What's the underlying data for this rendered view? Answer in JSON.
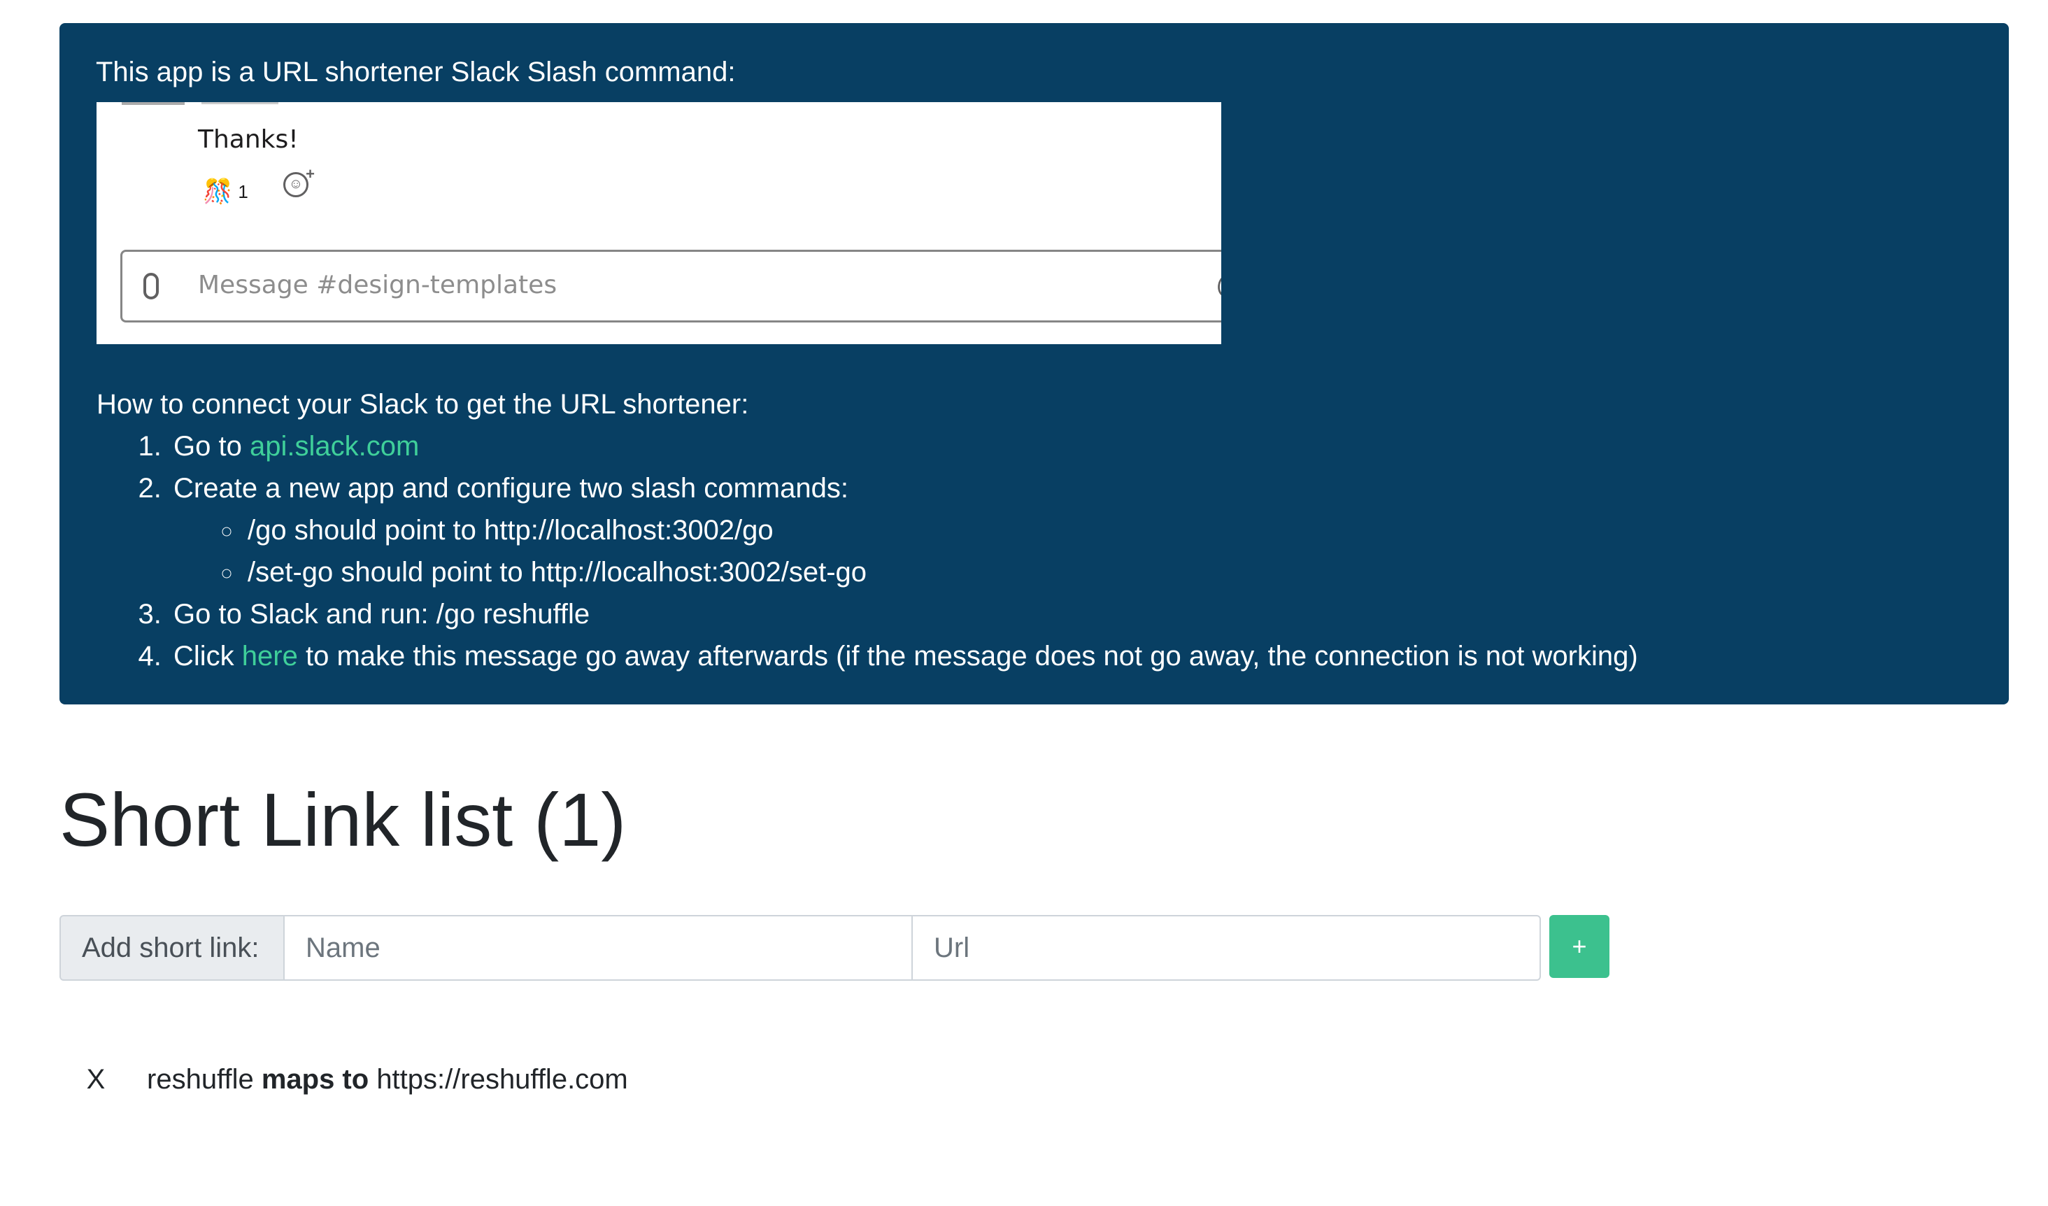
{
  "banner": {
    "intro": "This app is a URL shortener Slack Slash command:",
    "preview": {
      "message_text": "Thanks!",
      "reaction_emoji": "🎊",
      "reaction_count": "1",
      "composer_placeholder": "Message #design-templates",
      "icons": [
        "paperclip-icon",
        "add-reaction-icon",
        "at-icon"
      ]
    },
    "howto_heading": "How to connect your Slack to get the URL shortener:",
    "step1_prefix": "Go to",
    "step1_link": "api.slack.com",
    "step2": "Create a new app and configure two slash commands:",
    "step2_sub1": "/go should point to http://localhost:3002/go",
    "step2_sub2": "/set-go should point to http://localhost:3002/set-go",
    "step3": "Go to Slack and run: /go reshuffle",
    "step4_prefix": "Click",
    "step4_link": "here",
    "step4_suffix": "to make this message go away afterwards (if the message does not go away, the connection is not working)"
  },
  "title": "Short Link list (1)",
  "form": {
    "prefix_label": "Add short link:",
    "name_placeholder": "Name",
    "url_placeholder": "Url",
    "add_label": "+"
  },
  "links": [
    {
      "delete_label": "X",
      "name": "reshuffle",
      "connector": "maps to",
      "url": "https://reshuffle.com"
    }
  ],
  "colors": {
    "banner_bg": "#083f63",
    "link_accent": "#3fcf9a",
    "add_button": "#3cc18e"
  }
}
